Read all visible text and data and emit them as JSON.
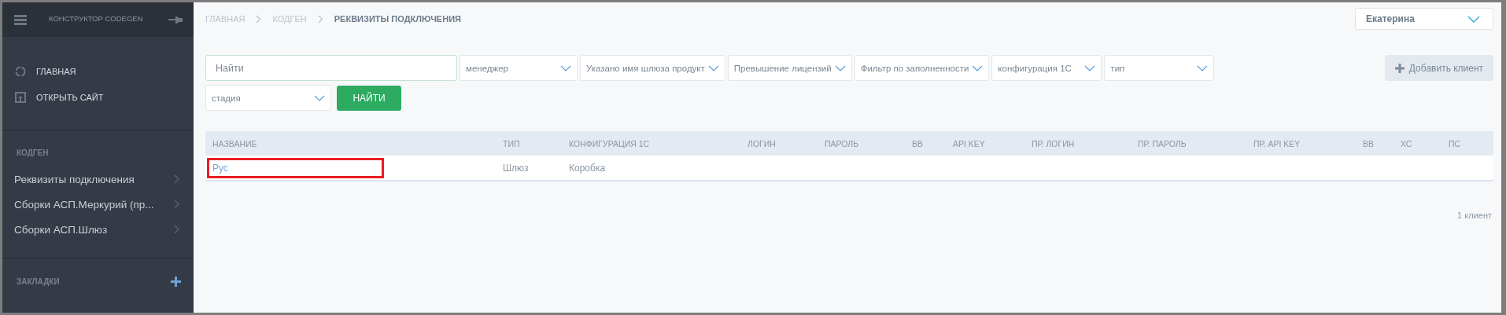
{
  "sidebar": {
    "title": "КОНСТРУКТОР CODEGEN",
    "nav": [
      {
        "label": "ГЛАВНАЯ"
      },
      {
        "label": "ОТКРЫТЬ САЙТ"
      }
    ],
    "sections": [
      {
        "title": "КОДГЕН",
        "add": false,
        "items": [
          {
            "label": "Реквизиты подключения"
          },
          {
            "label": "Сборки АСП.Меркурий (пр..."
          },
          {
            "label": "Сборки АСП.Шлюз"
          }
        ]
      },
      {
        "title": "ЗАКЛАДКИ",
        "add": true
      }
    ]
  },
  "breadcrumbs": [
    {
      "label": "ГЛАВНАЯ",
      "current": false
    },
    {
      "label": "КОДГЕН",
      "current": false
    },
    {
      "label": "РЕКВИЗИТЫ ПОДКЛЮЧЕНИЯ",
      "current": true
    }
  ],
  "user_menu": {
    "value": "Екатерина"
  },
  "search": {
    "placeholder": "Найти"
  },
  "filters": [
    {
      "placeholder": "менеджер"
    },
    {
      "placeholder": "Указано имя шлюза продукт"
    },
    {
      "placeholder": "Превышение лицензий"
    },
    {
      "placeholder": "Фильтр по заполненности"
    },
    {
      "placeholder": "конфигурация 1С"
    },
    {
      "placeholder": "тип"
    },
    {
      "placeholder": "стадия"
    }
  ],
  "find_button": "НАЙТИ",
  "add_button": "Добавить клиент",
  "table": {
    "columns": [
      "НАЗВАНИЕ",
      "ТИП",
      "КОНФИГУРАЦИЯ 1С",
      "ЛОГИН",
      "ПАРОЛЬ",
      "ВВ",
      "API KEY",
      "ПР. ЛОГИН",
      "ПР. ПАРОЛЬ",
      "ПР. API KEY",
      "ВВ",
      "ХС",
      "ПС"
    ],
    "rows": [
      {
        "highlighted": true,
        "cells": [
          "Рус",
          "Шлюз",
          "Коробка",
          "",
          "",
          "",
          "",
          "",
          "",
          "",
          "",
          "",
          ""
        ]
      }
    ]
  },
  "count": "1 клиент"
}
